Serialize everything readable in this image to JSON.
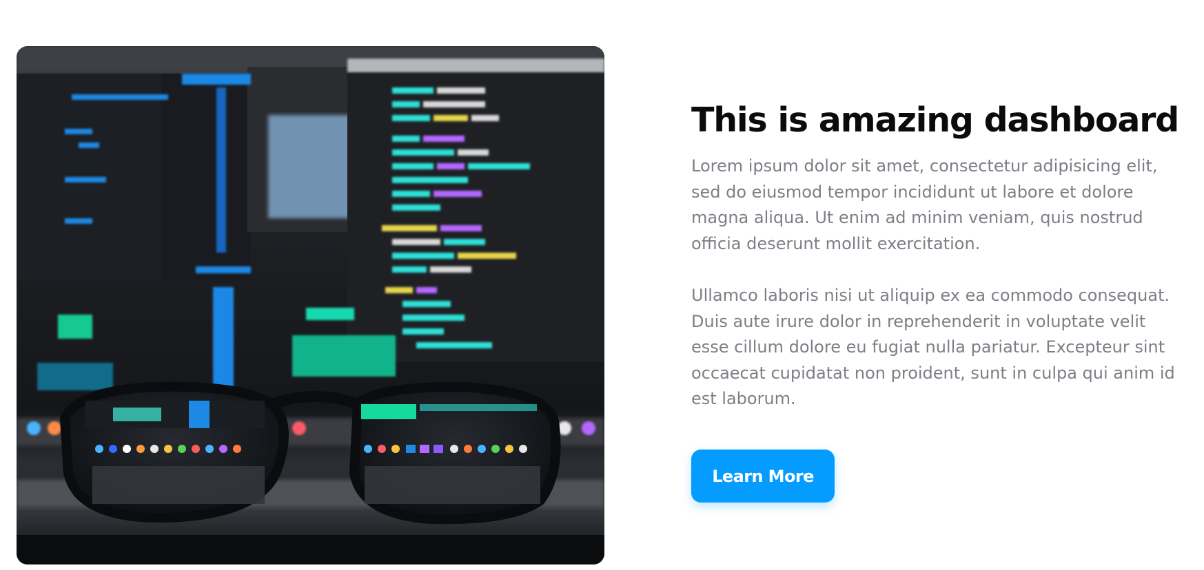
{
  "hero": {
    "image_icon": "monitor-code-glasses-photo",
    "colors": {
      "accent": "#049cff",
      "code_cyan": "#2fe0d6",
      "code_yellow": "#e6d44a",
      "code_purple": "#b468ff",
      "code_blue": "#1e88e5"
    }
  },
  "content": {
    "title": "This is amazing dashboard",
    "paragraph_1": "Lorem ipsum dolor sit amet, consectetur adipisicing elit, sed do eiusmod tempor incididunt ut labore et dolore magna aliqua. Ut enim ad minim veniam, quis nostrud officia deserunt mollit exercitation.",
    "paragraph_2": "Ullamco laboris nisi ut aliquip ex ea commodo consequat. Duis aute irure dolor in reprehenderit in voluptate velit esse cillum dolore eu fugiat nulla pariatur. Excepteur sint occaecat cupidatat non proident, sunt in culpa qui anim id est laborum.",
    "button_label": "Learn More"
  }
}
